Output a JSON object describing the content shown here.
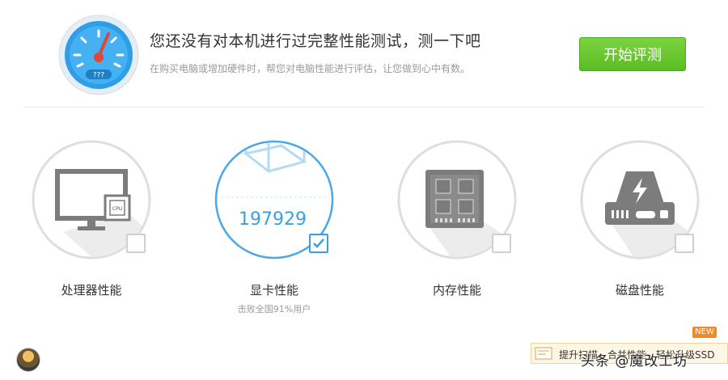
{
  "header": {
    "title": "您还没有对本机进行过完整性能测试，测一下吧",
    "subtitle": "在购买电脑或增加硬件时，帮您对电脑性能进行评估，让您做到心中有数。",
    "gauge_label": "???",
    "start_button": "开始评测"
  },
  "cards": [
    {
      "label": "处理器性能",
      "icon": "monitor-cpu-icon",
      "checked": false,
      "chip_label": "CPU"
    },
    {
      "label": "显卡性能",
      "icon": "cube-icon",
      "checked": true,
      "score": "197929",
      "sub": "击败全国91%用户"
    },
    {
      "label": "内存性能",
      "icon": "memory-chip-icon",
      "checked": false
    },
    {
      "label": "磁盘性能",
      "icon": "hard-drive-icon",
      "checked": false
    }
  ],
  "footer": {
    "notice_text": "提升扫描、合并性能，轻松升级SSD",
    "new_badge": "NEW",
    "watermark": "头条 @魔改工坊"
  },
  "colors": {
    "accent_blue": "#3ba0e0",
    "button_green": "#5bbd23",
    "badge_orange": "#f18a2a"
  }
}
